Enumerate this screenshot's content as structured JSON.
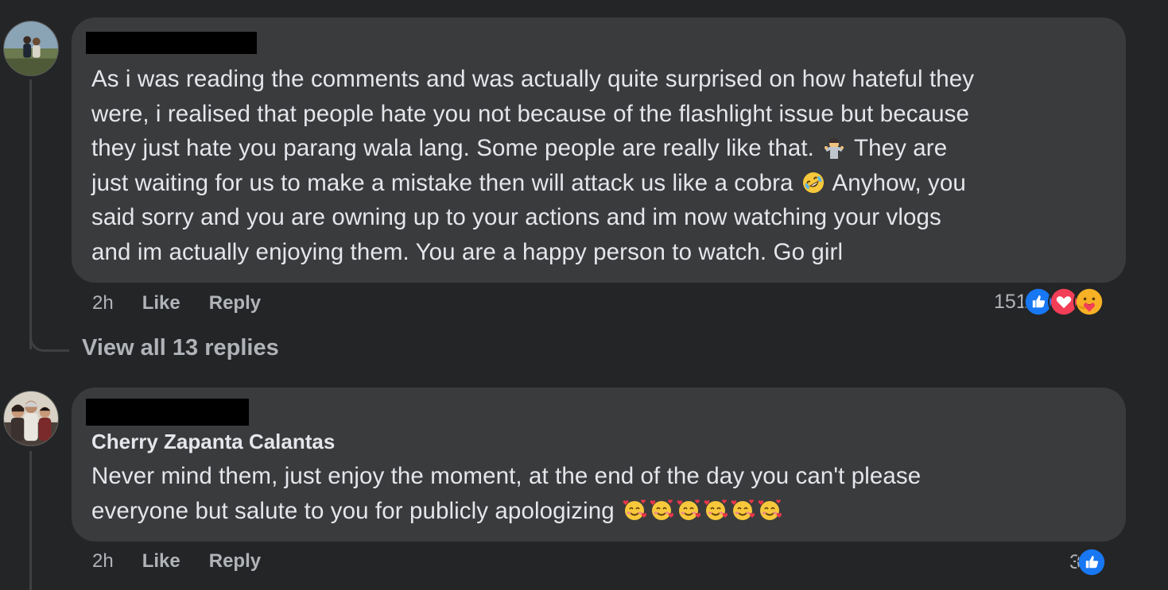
{
  "comments": [
    {
      "author": "",
      "text_parts": [
        "As i was reading the comments and was actually quite surprised on how hateful they\nwere, i realised that people hate you not because of the flashlight issue but because\nthey just hate you parang wala lang. Some people are really like that. ",
        " They are\njust waiting for us to make a mistake then will attack us like a cobra ",
        " Anyhow, you\nsaid sorry and you are owning up to your actions and im now watching your vlogs\nand im actually enjoying them. You are a happy person to watch. Go girl"
      ],
      "inline_emojis": [
        "person-shrugging-emoji",
        "rolling-on-floor-laughing-emoji"
      ],
      "time": "2h",
      "like_label": "Like",
      "reply_label": "Reply",
      "reaction_count": "151",
      "reactions": [
        "like-reaction-icon",
        "love-reaction-icon",
        "care-reaction-icon"
      ]
    },
    {
      "author": "Cherry Zapanta Calantas",
      "text_parts": [
        "Never mind them, just enjoy the moment, at the end of the day you can't please\neveryone but salute to you for publicly apologizing "
      ],
      "inline_emojis": [
        "smiling-face-with-hearts-emoji",
        "smiling-face-with-hearts-emoji",
        "smiling-face-with-hearts-emoji",
        "smiling-face-with-hearts-emoji",
        "smiling-face-with-hearts-emoji",
        "smiling-face-with-hearts-emoji"
      ],
      "time": "2h",
      "like_label": "Like",
      "reply_label": "Reply",
      "reaction_count": "3",
      "reactions": [
        "like-reaction-icon"
      ]
    }
  ],
  "view_replies_label": "View all 13 replies",
  "colors": {
    "background": "#242526",
    "bubble": "#3a3b3c",
    "text": "#e4e6eb",
    "secondary_text": "#b0b3b8",
    "like_blue": "#1877f2",
    "love_red": "#f33e58",
    "care_yellow": "#f7b125"
  }
}
